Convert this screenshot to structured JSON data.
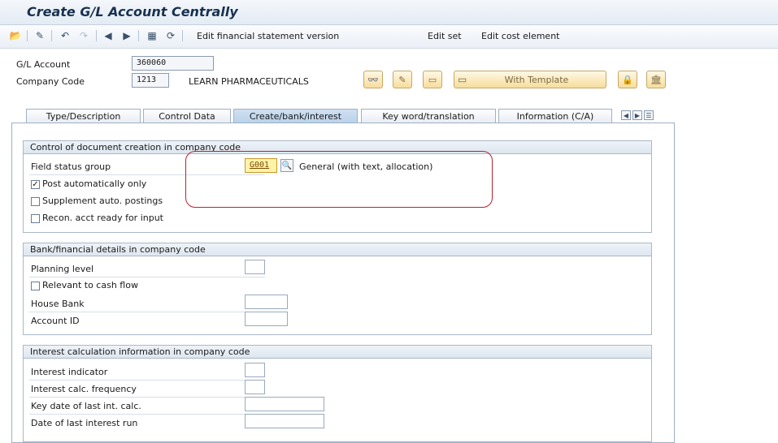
{
  "window": {
    "title": "Create G/L Account Centrally"
  },
  "toolbar": {
    "links": [
      "Edit financial statement version",
      "Edit set",
      "Edit cost element"
    ]
  },
  "header": {
    "gl_account_label": "G/L Account",
    "gl_account_value": "360060",
    "company_code_label": "Company Code",
    "company_code_value": "1213",
    "company_name": "LEARN PHARMACEUTICALS",
    "with_template_label": "With Template"
  },
  "tabs": [
    {
      "label": "Type/Description",
      "active": false
    },
    {
      "label": "Control Data",
      "active": false
    },
    {
      "label": "Create/bank/interest",
      "active": true
    },
    {
      "label": "Key word/translation",
      "active": false
    },
    {
      "label": "Information (C/A)",
      "active": false
    }
  ],
  "doc_control": {
    "title": "Control of document creation in company code",
    "field_status_label": "Field status group",
    "field_status_value": "G001",
    "field_status_desc": "General (with text, allocation)",
    "post_auto_label": "Post automatically only",
    "post_auto_checked": true,
    "supplement_label": "Supplement auto. postings",
    "recon_label": "Recon. acct ready for input"
  },
  "bank": {
    "title": "Bank/financial details in company code",
    "planning_level_label": "Planning level",
    "cash_flow_label": "Relevant to cash flow",
    "house_bank_label": "House Bank",
    "account_id_label": "Account ID"
  },
  "interest": {
    "title": "Interest calculation information in company code",
    "indicator_label": "Interest indicator",
    "frequency_label": "Interest calc. frequency",
    "key_date_label": "Key date of last int. calc.",
    "last_run_label": "Date of last interest run"
  },
  "colors": {
    "highlight": "#b8232e",
    "accent": "#19314f"
  }
}
